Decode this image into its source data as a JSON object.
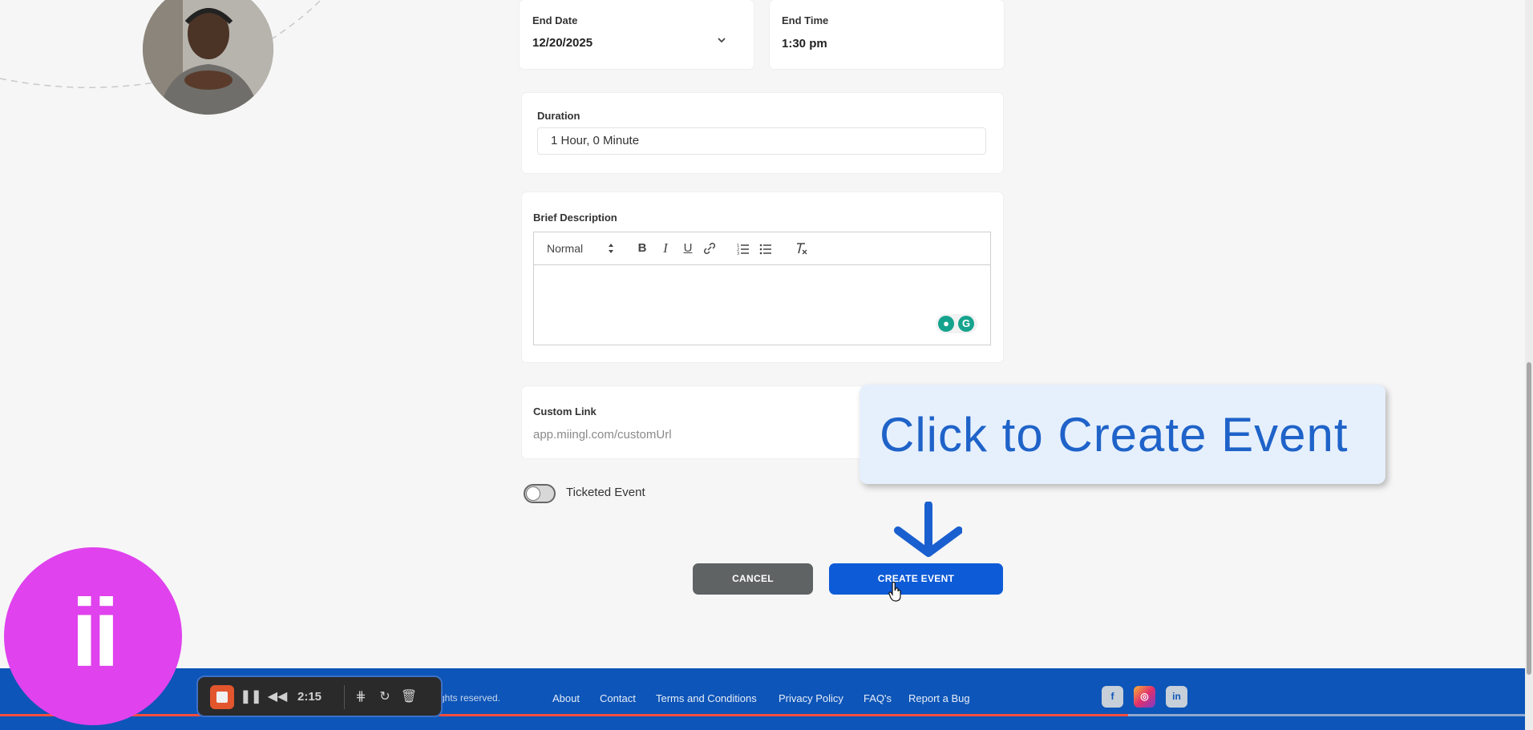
{
  "form": {
    "end_date": {
      "label": "End Date",
      "value": "12/20/2025"
    },
    "end_time": {
      "label": "End Time",
      "value": "1:30 pm"
    },
    "duration": {
      "label": "Duration",
      "value": "1 Hour, 0 Minute"
    },
    "description": {
      "label": "Brief Description",
      "toolbar": {
        "format_select": "Normal",
        "bold": "B",
        "italic": "I",
        "underline": "U",
        "link_icon": "link-icon",
        "ordered_list_icon": "ordered-list-icon",
        "bullet_list_icon": "bullet-list-icon",
        "clear_format_icon": "clear-format-icon"
      },
      "content": ""
    },
    "custom_link": {
      "label": "Custom Link",
      "placeholder": "app.miingl.com/customUrl"
    },
    "ticketed_event": {
      "label": "Ticketed Event",
      "enabled": false
    },
    "cancel_label": "CANCEL",
    "create_label": "CREATE EVENT"
  },
  "callout": {
    "text": "Click to Create Event"
  },
  "footer": {
    "rights": "ghts reserved.",
    "links": [
      "About",
      "Contact",
      "Terms and Conditions",
      "Privacy Policy",
      "FAQ's",
      "Report a Bug"
    ],
    "social": [
      "facebook-icon",
      "instagram-icon",
      "linkedin-icon"
    ]
  },
  "recorder": {
    "time": "2:15"
  },
  "brand": {
    "logo_text": "ii"
  },
  "colors": {
    "primary": "#0d5bd7",
    "footer": "#0d55b8",
    "cancel": "#5f6364",
    "callout_bg": "#e6f0fc",
    "callout_text": "#1f63c9",
    "brand": "#e042ee"
  },
  "video_progress": 0.74
}
